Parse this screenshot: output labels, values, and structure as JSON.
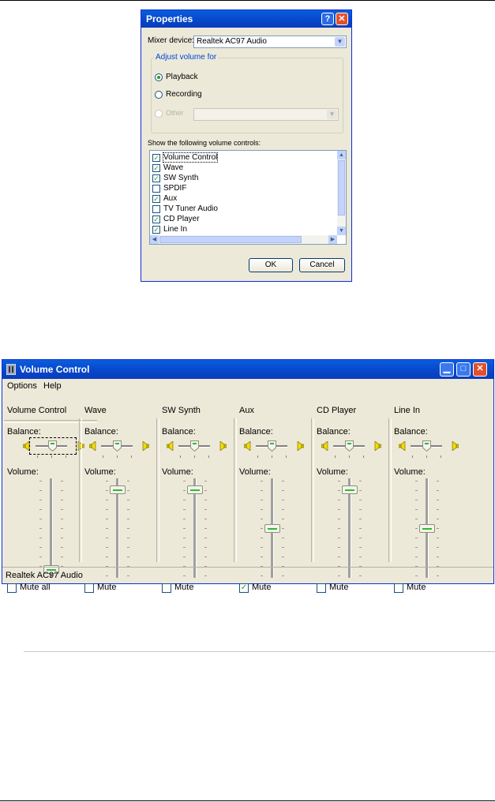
{
  "properties_dialog": {
    "title": "Properties",
    "help_glyph": "?",
    "close_glyph": "✕",
    "mixer_label": "Mixer device:",
    "mixer_value": "Realtek AC97 Audio",
    "adjust_group": "Adjust volume for",
    "radio_playback": "Playback",
    "radio_recording": "Recording",
    "radio_other": "Other",
    "show_label": "Show the following volume controls:",
    "controls": [
      {
        "label": "Volume Control",
        "checked": true
      },
      {
        "label": "Wave",
        "checked": true
      },
      {
        "label": "SW Synth",
        "checked": true
      },
      {
        "label": "SPDIF",
        "checked": false
      },
      {
        "label": "Aux",
        "checked": true
      },
      {
        "label": "TV Tuner Audio",
        "checked": false
      },
      {
        "label": "CD Player",
        "checked": true
      },
      {
        "label": "Line In",
        "checked": true
      }
    ],
    "ok": "OK",
    "cancel": "Cancel"
  },
  "volume_control": {
    "title": "Volume Control",
    "menu_options": "Options",
    "menu_help": "Help",
    "balance_label": "Balance:",
    "volume_label": "Volume:",
    "status": "Realtek AC97 Audio",
    "columns": [
      {
        "name": "Volume Control",
        "mute_label": "Mute all",
        "muted": false,
        "volume_level": 0.05
      },
      {
        "name": "Wave",
        "mute_label": "Mute",
        "muted": false,
        "volume_level": 0.92
      },
      {
        "name": "SW Synth",
        "mute_label": "Mute",
        "muted": false,
        "volume_level": 0.92
      },
      {
        "name": "Aux",
        "mute_label": "Mute",
        "muted": true,
        "volume_level": 0.5
      },
      {
        "name": "CD Player",
        "mute_label": "Mute",
        "muted": false,
        "volume_level": 0.92
      },
      {
        "name": "Line In",
        "mute_label": "Mute",
        "muted": false,
        "volume_level": 0.5
      }
    ]
  }
}
